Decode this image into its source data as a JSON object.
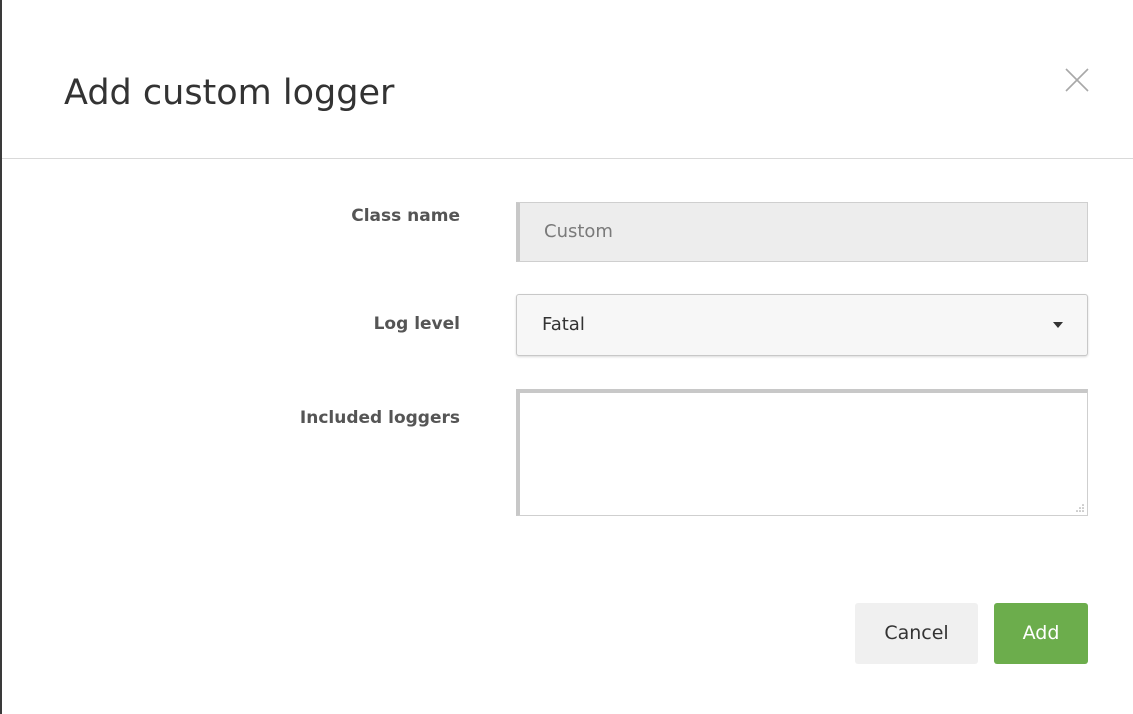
{
  "dialog": {
    "title": "Add custom logger",
    "close_icon": "close-icon"
  },
  "form": {
    "class_name": {
      "label": "Class name",
      "value": "Custom"
    },
    "log_level": {
      "label": "Log level",
      "selected": "Fatal",
      "icon": "caret-down-icon"
    },
    "included_loggers": {
      "label": "Included loggers",
      "value": ""
    }
  },
  "buttons": {
    "cancel": "Cancel",
    "add": "Add"
  },
  "colors": {
    "primary_button": "#6cad4c",
    "secondary_button": "#f0f0f0",
    "disabled_field": "#ededed"
  }
}
